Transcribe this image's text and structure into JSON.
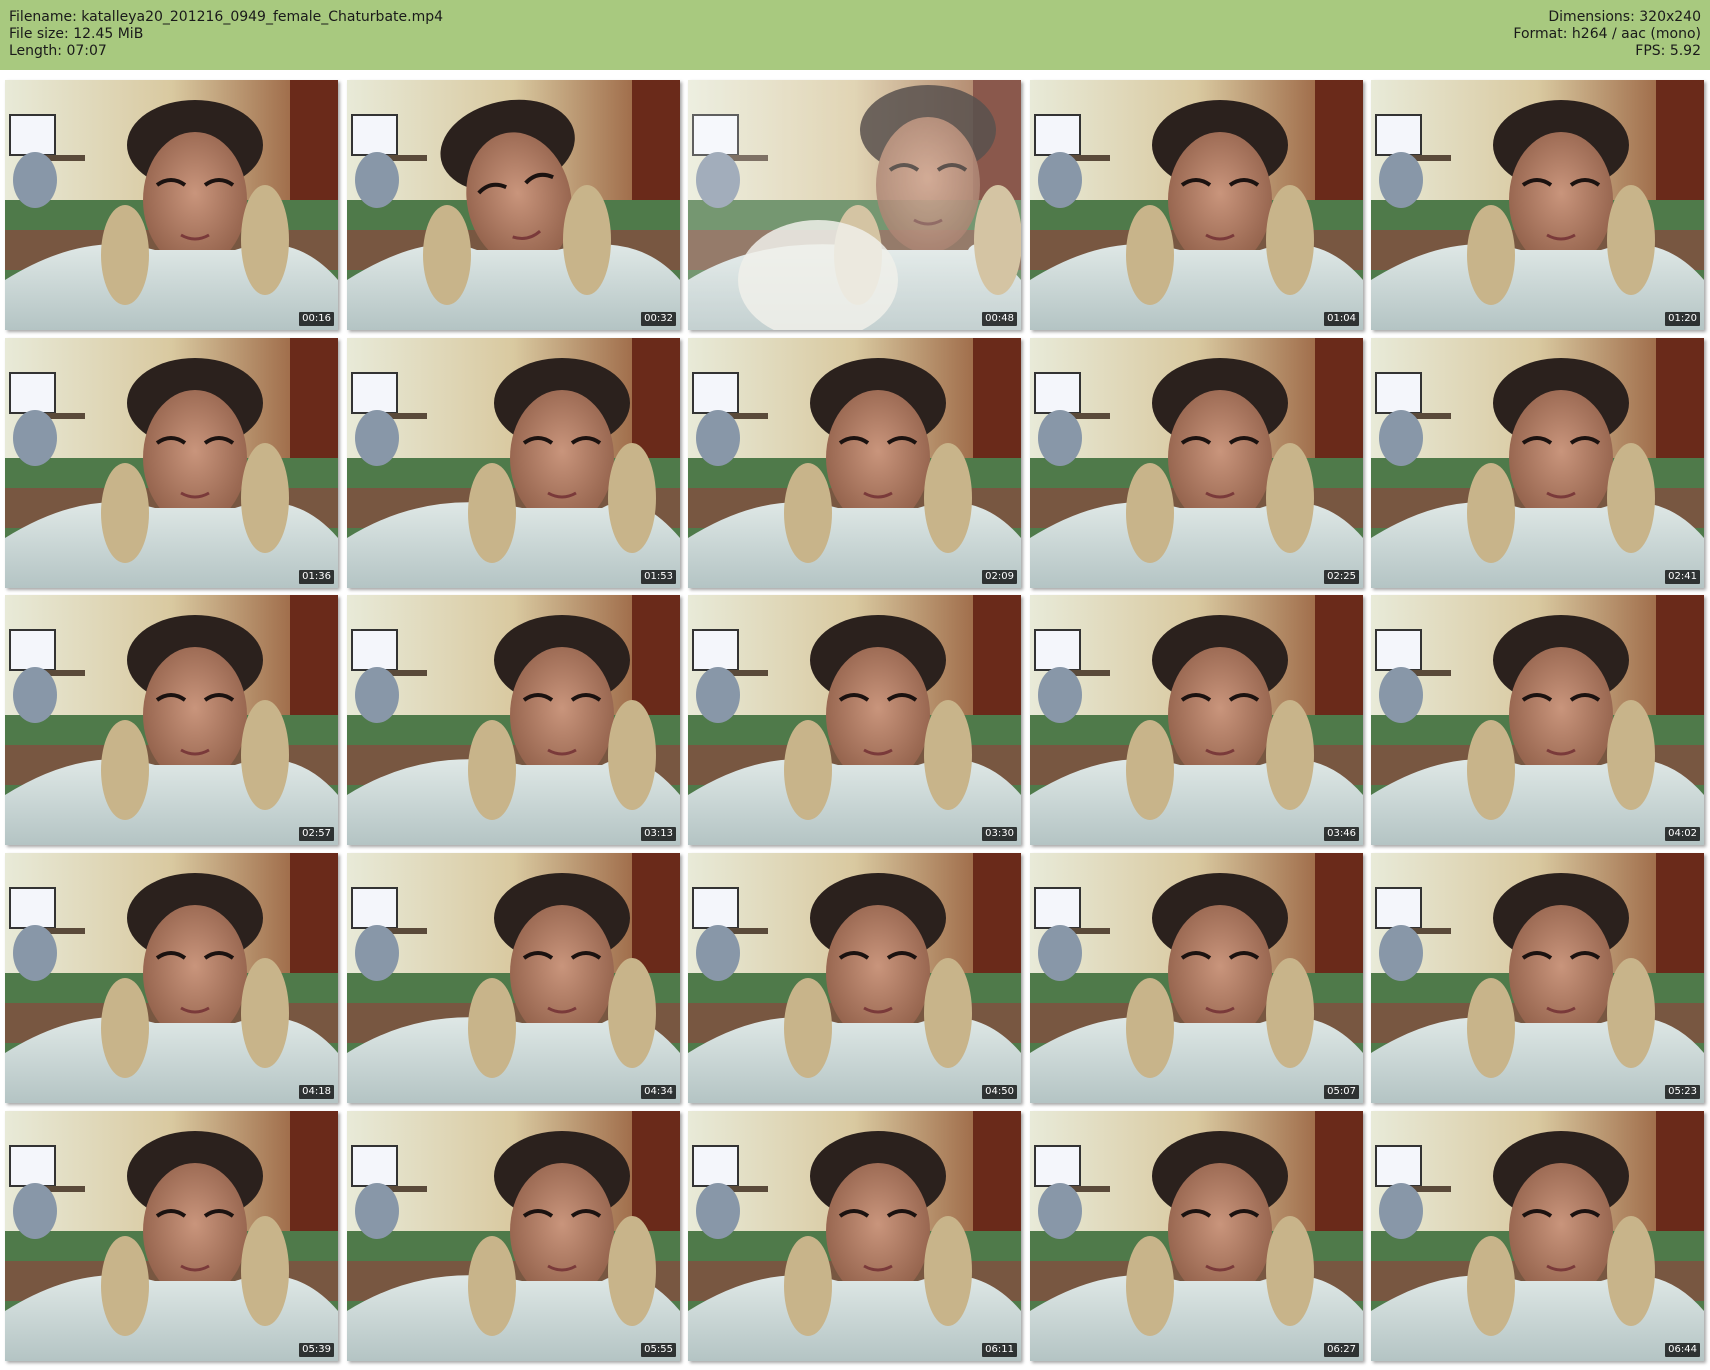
{
  "header": {
    "filename_line": "Filename: katalleya20_201216_0949_female_Chaturbate.mp4",
    "filesize_line": "File size: 12.45 MiB",
    "length_line": "Length: 07:07",
    "dimensions_line": "Dimensions: 320x240",
    "format_line": "Format: h264 / aac (mono)",
    "fps_line": "FPS: 5.92"
  },
  "colors": {
    "header_bg": "#a8c97f",
    "timestamp_bg": "#000000",
    "timestamp_fg": "#ffffff"
  },
  "thumbnails": [
    {
      "timestamp": "00:16",
      "variant": "face"
    },
    {
      "timestamp": "00:32",
      "variant": "face-tilted"
    },
    {
      "timestamp": "00:48",
      "variant": "blurred"
    },
    {
      "timestamp": "01:04",
      "variant": "face"
    },
    {
      "timestamp": "01:20",
      "variant": "face"
    },
    {
      "timestamp": "01:36",
      "variant": "face"
    },
    {
      "timestamp": "01:53",
      "variant": "face-right"
    },
    {
      "timestamp": "02:09",
      "variant": "face"
    },
    {
      "timestamp": "02:25",
      "variant": "face"
    },
    {
      "timestamp": "02:41",
      "variant": "face"
    },
    {
      "timestamp": "02:57",
      "variant": "face"
    },
    {
      "timestamp": "03:13",
      "variant": "face-right"
    },
    {
      "timestamp": "03:30",
      "variant": "face"
    },
    {
      "timestamp": "03:46",
      "variant": "face"
    },
    {
      "timestamp": "04:02",
      "variant": "face"
    },
    {
      "timestamp": "04:18",
      "variant": "face"
    },
    {
      "timestamp": "04:34",
      "variant": "face-right"
    },
    {
      "timestamp": "04:50",
      "variant": "face"
    },
    {
      "timestamp": "05:07",
      "variant": "face"
    },
    {
      "timestamp": "05:23",
      "variant": "face"
    },
    {
      "timestamp": "05:39",
      "variant": "face"
    },
    {
      "timestamp": "05:55",
      "variant": "face-right"
    },
    {
      "timestamp": "06:11",
      "variant": "face"
    },
    {
      "timestamp": "06:27",
      "variant": "face"
    },
    {
      "timestamp": "06:44",
      "variant": "face"
    }
  ]
}
